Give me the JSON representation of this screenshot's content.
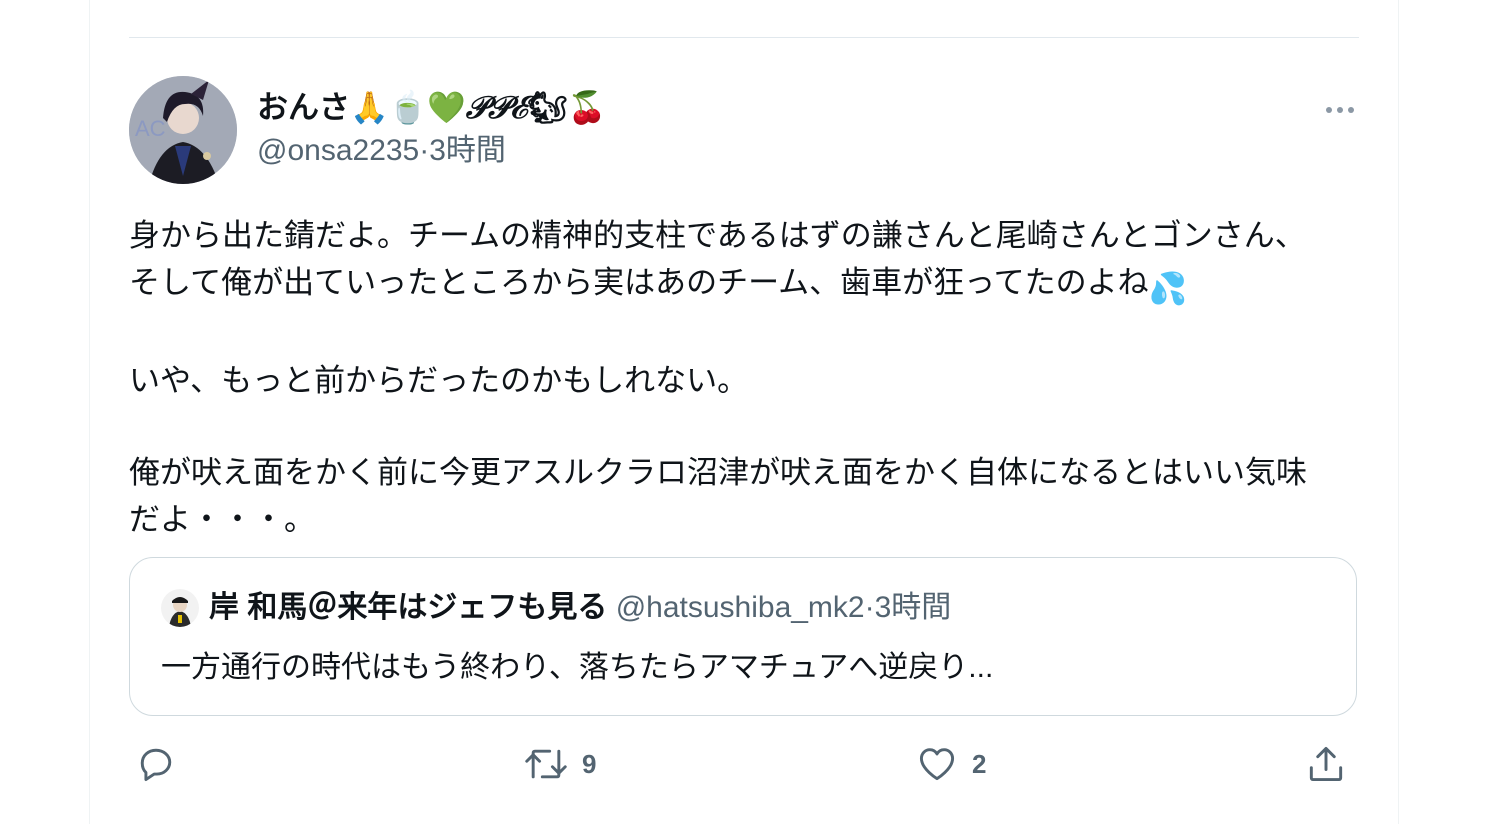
{
  "tweet": {
    "display_name": "おんさ",
    "name_emojis": "🙏🍵💚",
    "name_script": "𝒫𝒫ℰ",
    "name_emojis_tail": "🐿🍒",
    "handle": "@onsa2235",
    "separator": "·",
    "time": "3時間",
    "lines": [
      "身から出た錆だよ。チームの精神的支柱であるはずの謙さんと尾崎さんとゴンさん、",
      "そして俺が出ていったところから実はあのチーム、歯車が狂ってたのよね",
      "いや、もっと前からだったのかもしれない。",
      "俺が吠え面をかく前に今更アスルクラロ沼津が吠え面をかく自体になるとはいい気味",
      "だよ・・・。"
    ],
    "line2_emoji": "💦"
  },
  "quote": {
    "display_name": "岸 和馬＠来年はジェフも見る",
    "handle": "@hatsushiba_mk2",
    "separator": "·",
    "time": "3時間",
    "text": "一方通行の時代はもう終わり、落ちたらアマチュアへ逆戻り..."
  },
  "actions": {
    "reply_count": "",
    "retweet_count": "9",
    "like_count": "2"
  },
  "colors": {
    "text_primary": "#0f1419",
    "text_secondary": "#536471",
    "border": "#cfd9de"
  }
}
